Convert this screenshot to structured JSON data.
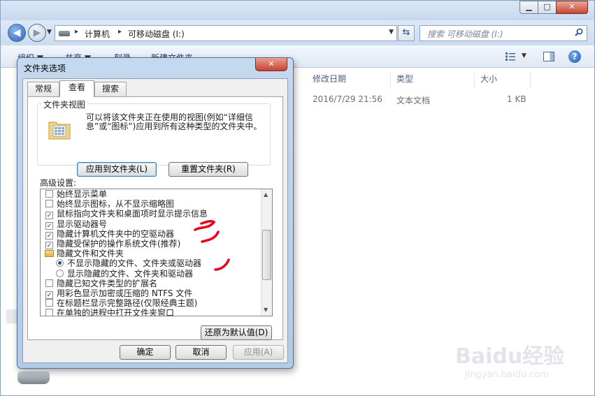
{
  "explorer": {
    "window_controls": {
      "minimize": "▁",
      "maximize": "□",
      "close": "✕"
    },
    "nav": {
      "back": "◀",
      "forward": "▶",
      "history": "▼"
    },
    "address": {
      "sep": "▸",
      "crumbs": [
        "计算机",
        "可移动磁盘 (I:)"
      ],
      "dropdown": "▼"
    },
    "refresh": "⇆",
    "search": {
      "placeholder": "搜索 可移动磁盘 (I:)"
    },
    "commands": [
      "组织 ▼",
      "共享 ▼",
      "刻录",
      "新建文件夹"
    ],
    "views_drop": "▼",
    "help": "?",
    "columns": {
      "modified": "修改日期",
      "type": "类型",
      "size": "大小"
    },
    "row": {
      "date": "2016/7/29 21:56",
      "type": "文本文档",
      "size": "1 KB"
    }
  },
  "dialog": {
    "title": "文件夹选项",
    "close": "✕",
    "tabs": {
      "general": "常规",
      "view": "查看",
      "search": "搜索"
    },
    "folder_view": {
      "legend": "文件夹视图",
      "description": "可以将该文件夹正在使用的视图(例如“详细信息”或“图标”)应用到所有这种类型的文件夹中。",
      "apply_button": "应用到文件夹(L)",
      "reset_button": "重置文件夹(R)"
    },
    "advanced_label": "高级设置:",
    "advanced_items": [
      {
        "kind": "check",
        "checked": false,
        "label": "始终显示菜单"
      },
      {
        "kind": "check",
        "checked": false,
        "label": "始终显示图标，从不显示缩略图"
      },
      {
        "kind": "check",
        "checked": true,
        "label": "鼠标指向文件夹和桌面项时显示提示信息"
      },
      {
        "kind": "check",
        "checked": true,
        "label": "显示驱动器号"
      },
      {
        "kind": "check",
        "checked": true,
        "label": "隐藏计算机文件夹中的空驱动器"
      },
      {
        "kind": "check",
        "checked": true,
        "label": "隐藏受保护的操作系统文件(推荐)"
      },
      {
        "kind": "folder",
        "label": "隐藏文件和文件夹"
      },
      {
        "kind": "radio",
        "selected": true,
        "label": "不显示隐藏的文件、文件夹或驱动器"
      },
      {
        "kind": "radio",
        "selected": false,
        "label": "显示隐藏的文件、文件夹和驱动器"
      },
      {
        "kind": "check",
        "checked": false,
        "label": "隐藏已知文件类型的扩展名"
      },
      {
        "kind": "check",
        "checked": true,
        "label": "用彩色显示加密或压缩的 NTFS 文件"
      },
      {
        "kind": "check",
        "checked": false,
        "label": "在标题栏显示完整路径(仅限经典主题)"
      },
      {
        "kind": "check",
        "checked": false,
        "label": "在单独的进程中打开文件夹窗口"
      }
    ],
    "check_mark": "✓",
    "scroll": {
      "up": "▲",
      "down": "▼"
    },
    "restore_button": "还原为默认值(D)",
    "ok_button": "确定",
    "cancel_button": "取消",
    "apply_button": "应用(A)"
  },
  "watermark": {
    "logo": "Baidu经验",
    "sub": "jingyan.baidu.com"
  },
  "colors": {
    "annotation_red": "#e8001c",
    "accent_blue": "#1e4c9a"
  }
}
